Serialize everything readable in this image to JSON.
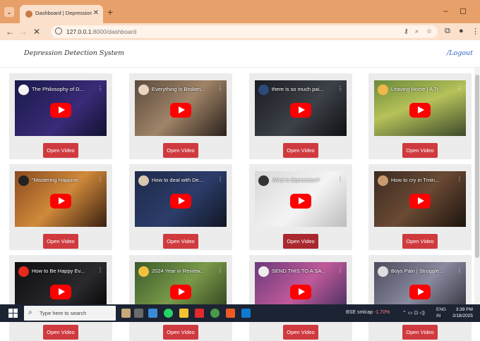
{
  "browser": {
    "tab_title": "Dashboard | Depression Detecti",
    "url_host": "127.0.0.1",
    "url_port_path": ":8000/dashboard",
    "accent": "#e8a06a"
  },
  "app": {
    "brand": "Depression Detection System",
    "logout": "/Logout"
  },
  "videos": [
    {
      "title": "The Philosophy of D...",
      "button": "Open Video"
    },
    {
      "title": "Everything Is Broken...",
      "button": "Open Video"
    },
    {
      "title": "there is so much pai...",
      "button": "Open Video"
    },
    {
      "title": "Leaving Home | A Tr...",
      "button": "Open Video"
    },
    {
      "title": "\"Mastering Happine...",
      "button": "Open Video"
    },
    {
      "title": "How to deal with De...",
      "button": "Open Video"
    },
    {
      "title": "What is depression?",
      "button": "Open Video"
    },
    {
      "title": "How to cry in Tmin...",
      "button": "Open Video"
    },
    {
      "title": "How to Be Happy Ev...",
      "button": "Open Video"
    },
    {
      "title": "2024 Year in Review...",
      "button": "Open Video"
    },
    {
      "title": "SEND THIS TO A SA...",
      "button": "Open Video"
    },
    {
      "title": "Boys Pain | Struggle...",
      "button": "Open Video"
    }
  ],
  "taskbar": {
    "search_placeholder": "Type here to search",
    "stock_label": "BSE smlcap",
    "stock_change": "-1.70%",
    "lang_top": "ENG",
    "lang_bottom": "IN",
    "time": "3:39 PM",
    "date": "2/18/2025"
  }
}
